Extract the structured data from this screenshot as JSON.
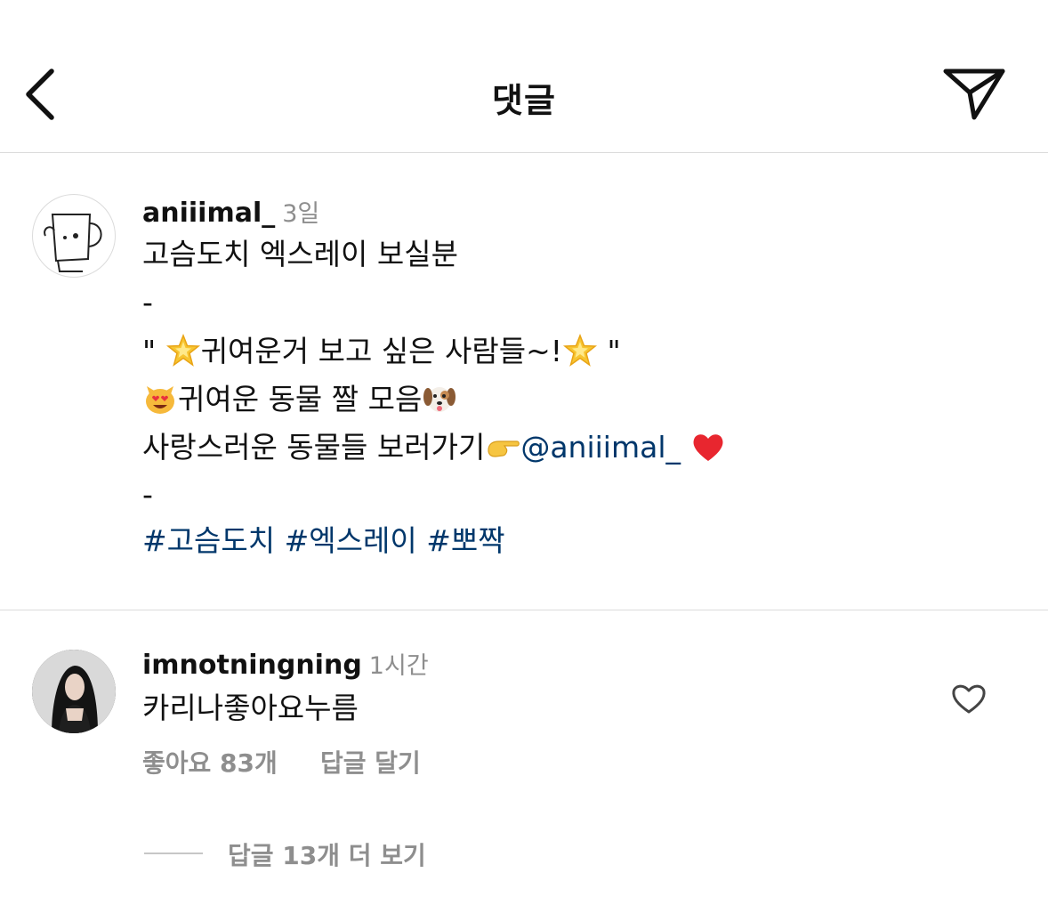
{
  "header": {
    "title": "댓글"
  },
  "caption": {
    "username": "aniiimal_",
    "time": "3일",
    "line1": "고슴도치 엑스레이 보실분",
    "dash1": "-",
    "line3_open": "\"",
    "line3_text": "귀여운거 보고 싶은 사람들~!",
    "line3_close": "\"",
    "line4_text": "귀여운 동물 짤 모음",
    "line5_text": "사랑스러운 동물들 보러가기",
    "mention": "@aniiimal_",
    "dash2": "-",
    "hashtags": [
      "#고슴도치",
      "#엑스레이",
      "#뽀짝"
    ]
  },
  "comment": {
    "username": "imnotningning",
    "time": "1시간",
    "text": "카리나좋아요누름",
    "likes_label": "좋아요 83개",
    "reply_label": "답글 달기",
    "view_replies_label": "답글 13개 더 보기"
  }
}
